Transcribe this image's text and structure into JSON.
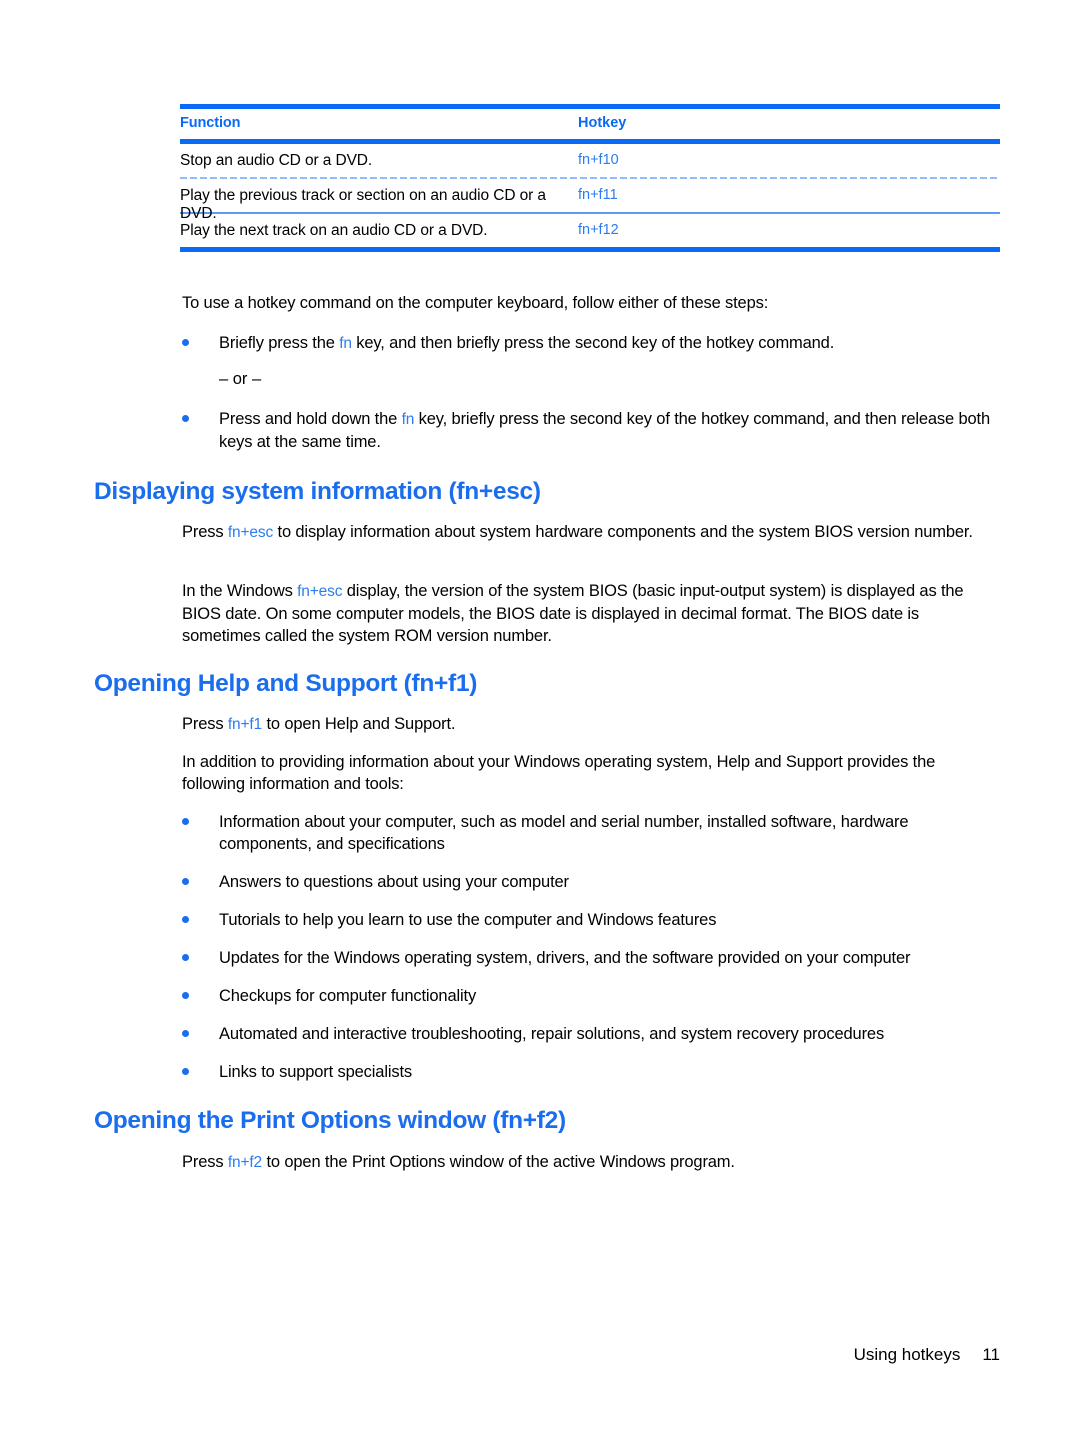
{
  "colors": {
    "accent_blue": "#0a69f5",
    "heading_blue": "#1a6dec",
    "code_blue": "#2a7cf0",
    "rule_thin_blue": "#5a9bf7",
    "text_black": "#000000",
    "page_background": "#ffffff"
  },
  "table": {
    "columns": [
      "Function",
      "Hotkey"
    ],
    "rows": [
      {
        "function": "Stop an audio CD or a DVD.",
        "hotkey": "fn+f10"
      },
      {
        "function": "Play the previous track or section on an audio CD or a DVD.",
        "hotkey": "fn+f11"
      },
      {
        "function": "Play the next track on an audio CD or a DVD.",
        "hotkey": "fn+f12"
      }
    ]
  },
  "intro": {
    "lead": "To use a hotkey command on the computer keyboard, follow either of these steps:",
    "bullet1_part1": "Briefly press the ",
    "bullet1_code": "fn",
    "bullet1_part2": " key, and then briefly press the second key of the hotkey command.",
    "or_separator": "– or –",
    "bullet2_part1": "Press and hold down the ",
    "bullet2_code": "fn",
    "bullet2_part2": " key, briefly press the second key of the hotkey command, and then release both keys at the same time."
  },
  "section_sysinfo": {
    "heading": "Displaying system information (fn+esc)",
    "p1_part1": "Press ",
    "p1_code": "fn+esc",
    "p1_part2": " to display information about system hardware components and the system BIOS version number.",
    "p2_part1": "In the Windows ",
    "p2_code": "fn+esc",
    "p2_part2": " display, the version of the system BIOS (basic input-output system) is displayed as the BIOS date. On some computer models, the BIOS date is displayed in decimal format. The BIOS date is sometimes called the system ROM version number."
  },
  "section_help": {
    "heading": "Opening Help and Support (fn+f1)",
    "p1_part1": "Press ",
    "p1_code": "fn+f1",
    "p1_part2": " to open Help and Support.",
    "p2": "In addition to providing information about your Windows operating system, Help and Support provides the following information and tools:",
    "bullets": [
      "Information about your computer, such as model and serial number, installed software, hardware components, and specifications",
      "Answers to questions about using your computer",
      "Tutorials to help you learn to use the computer and Windows features",
      "Updates for the Windows operating system, drivers, and the software provided on your computer",
      "Checkups for computer functionality",
      "Automated and interactive troubleshooting, repair solutions, and system recovery procedures",
      "Links to support specialists"
    ]
  },
  "section_print": {
    "heading": "Opening the Print Options window (fn+f2)",
    "p1_part1": "Press ",
    "p1_code": "fn+f2",
    "p1_part2": " to open the Print Options window of the active Windows program."
  },
  "footer": {
    "label": "Using hotkeys",
    "page_number": "11"
  }
}
